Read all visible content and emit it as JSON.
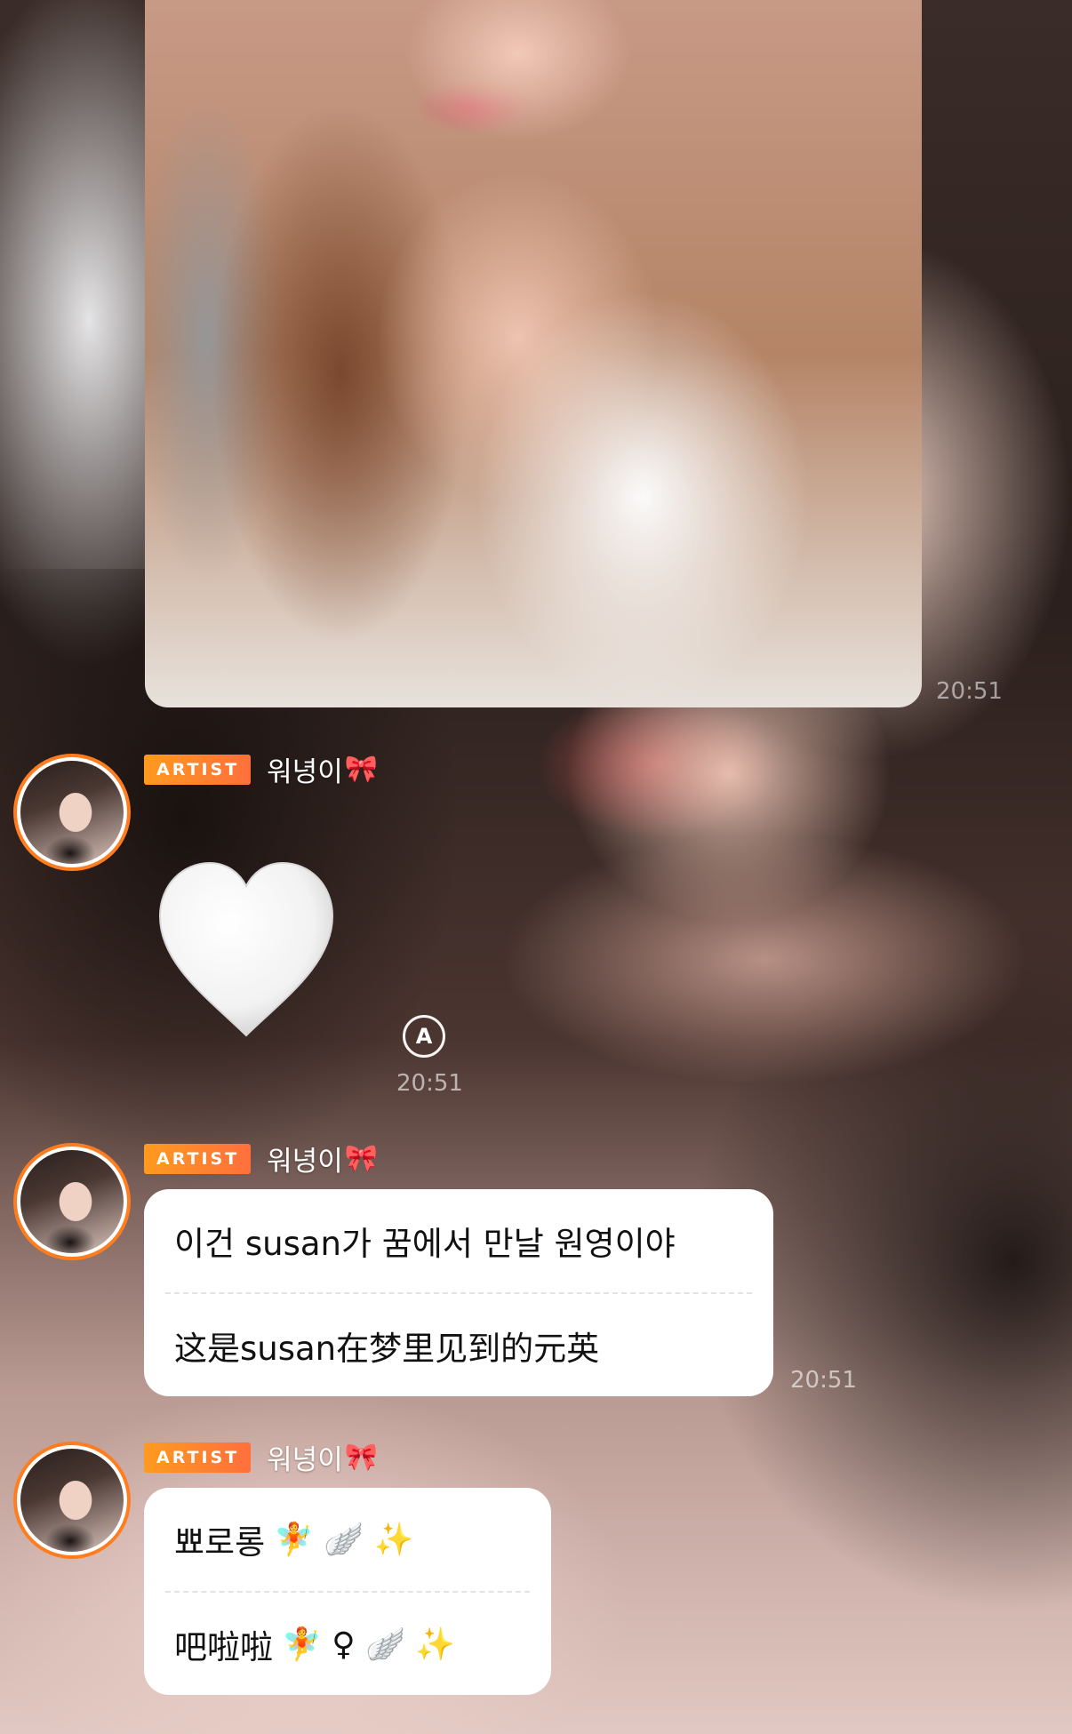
{
  "photo_message": {
    "time": "20:51"
  },
  "messages": [
    {
      "badge": "ARTIST",
      "sender": "워녕이",
      "sender_emoji": "🎀",
      "sticker": "white-heart",
      "translate_icon_label": "A",
      "time": "20:51"
    },
    {
      "badge": "ARTIST",
      "sender": "워녕이",
      "sender_emoji": "🎀",
      "original": "이건 susan가 꿈에서 만날 원영이야",
      "translation": "这是susan在梦里见到的元英",
      "time": "20:51"
    },
    {
      "badge": "ARTIST",
      "sender": "워녕이",
      "sender_emoji": "🎀",
      "original_text": "뾰로롱",
      "original_emojis": "🧚 🪽 ✨",
      "translation_text": "吧啦啦",
      "translation_emojis": "🧚 ♀ 🪽 ✨"
    }
  ],
  "colors": {
    "badge_start": "#ff9a1f",
    "badge_end": "#ff6f3c",
    "avatar_ring": "#ff7d1f",
    "bubble_bg": "#ffffff"
  }
}
